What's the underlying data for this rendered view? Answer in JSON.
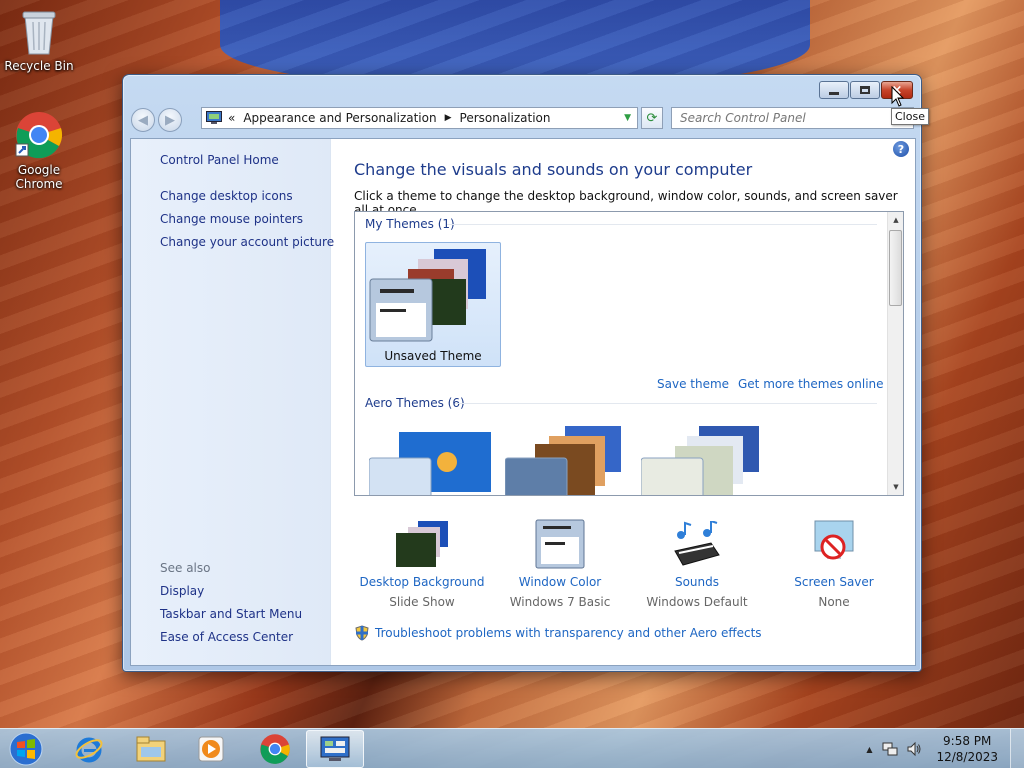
{
  "desktop": {
    "icons": [
      {
        "label": "Recycle Bin",
        "icon": "recycle-bin-icon"
      },
      {
        "label": "Google Chrome",
        "icon": "chrome-icon"
      }
    ]
  },
  "window": {
    "caption_buttons": {
      "minimize": "minimize",
      "maximize": "maximize",
      "close": "×"
    },
    "tooltip": "Close",
    "address": {
      "overflow": "«",
      "crumbs": [
        "Appearance and Personalization",
        "Personalization"
      ],
      "separator": "▶"
    },
    "search_placeholder": "Search Control Panel",
    "left_pane": {
      "home": "Control Panel Home",
      "links": [
        "Change desktop icons",
        "Change mouse pointers",
        "Change your account picture"
      ],
      "see_also_title": "See also",
      "see_also": [
        "Display",
        "Taskbar and Start Menu",
        "Ease of Access Center"
      ]
    },
    "main": {
      "heading": "Change the visuals and sounds on your computer",
      "description": "Click a theme to change the desktop background, window color, sounds, and screen saver all at once.",
      "my_themes_title": "My Themes (1)",
      "unsaved_theme": "Unsaved Theme",
      "save_theme": "Save theme",
      "get_more": "Get more themes online",
      "aero_themes_title": "Aero Themes (6)",
      "help": "?"
    },
    "bottom": [
      {
        "title": "Desktop Background",
        "sub": "Slide Show"
      },
      {
        "title": "Window Color",
        "sub": "Windows 7 Basic"
      },
      {
        "title": "Sounds",
        "sub": "Windows Default"
      },
      {
        "title": "Screen Saver",
        "sub": "None"
      }
    ],
    "troubleshoot": "Troubleshoot problems with transparency and other Aero effects"
  },
  "taskbar": {
    "apps": [
      "internet-explorer-icon",
      "windows-explorer-icon",
      "media-player-icon",
      "chrome-icon",
      "control-panel-icon"
    ],
    "tray_arrow": "▲",
    "time": "9:58 PM",
    "date": "12/8/2023"
  }
}
